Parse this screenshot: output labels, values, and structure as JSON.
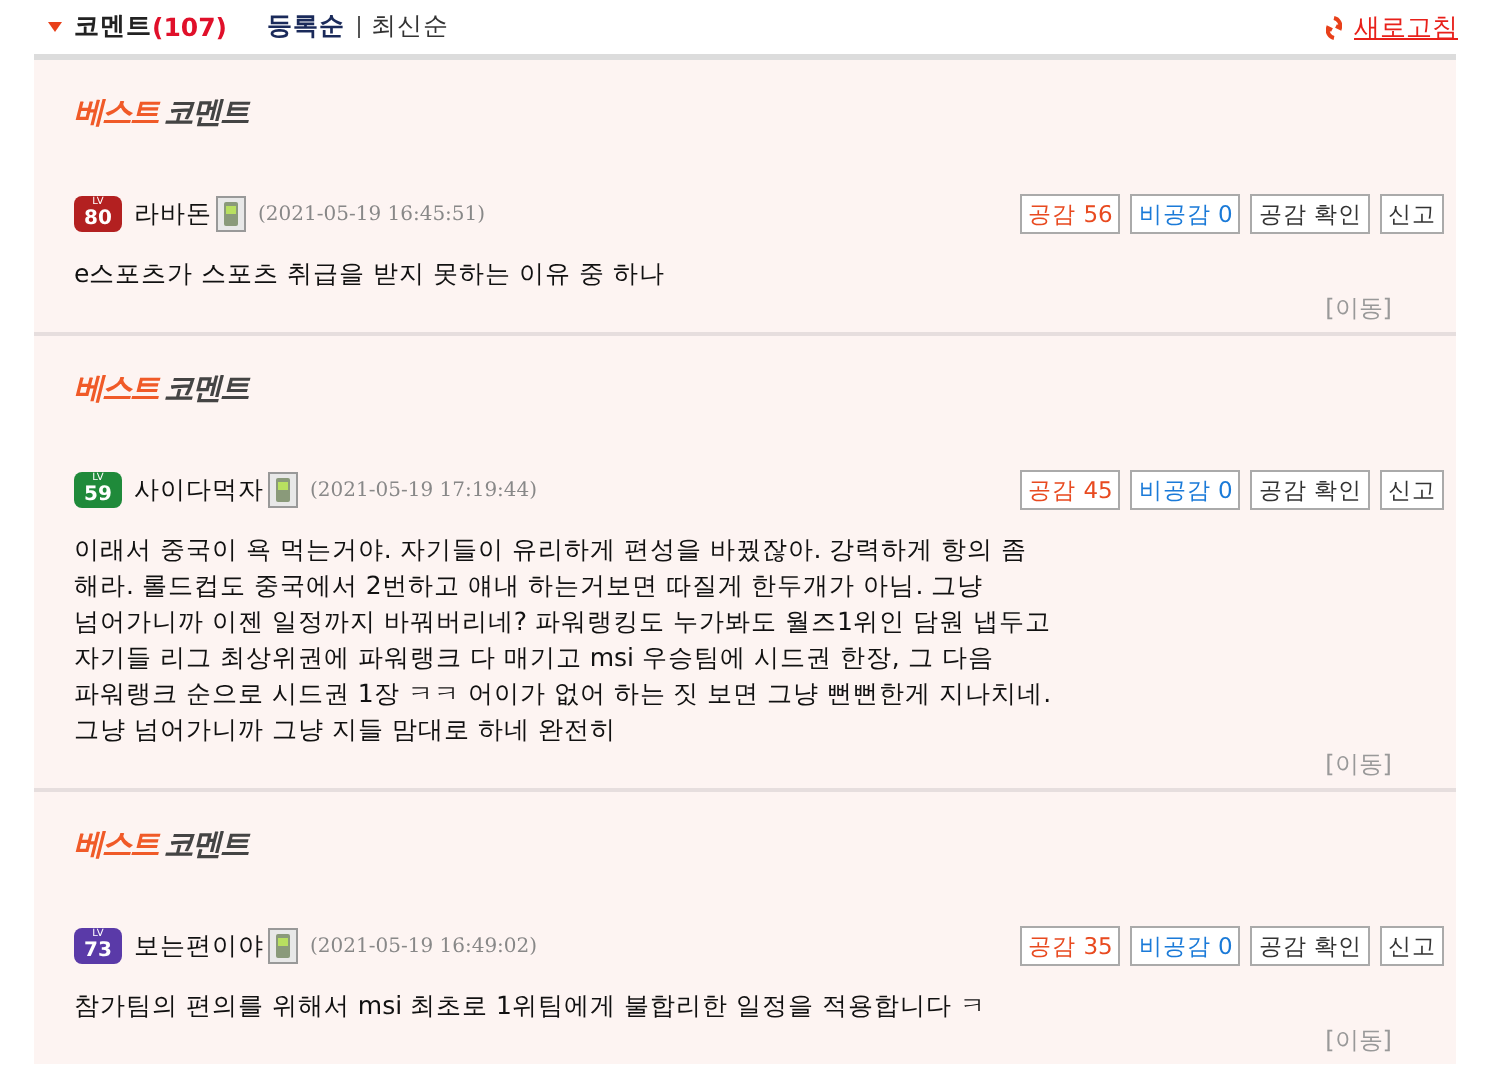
{
  "header": {
    "title": "코멘트",
    "count": "(107)",
    "sort_options": [
      {
        "label": "등록순",
        "selected": true
      },
      {
        "label": "최신순",
        "selected": false
      }
    ],
    "refresh": "새로고침"
  },
  "comments": [
    {
      "best_label": {
        "highlight": "베스트",
        "rest": "코멘트"
      },
      "level": {
        "label": "LV",
        "value": "80",
        "color": "#b32020"
      },
      "author": "라바돈",
      "date": "(2021-05-19 16:45:51)",
      "buttons": {
        "like": "공감 56",
        "dislike": "비공감 0",
        "check": "공감 확인",
        "report": "신고"
      },
      "text": "e스포츠가 스포츠 취급을 받지 못하는 이유 중 하나",
      "move": "[이동]"
    },
    {
      "best_label": {
        "highlight": "베스트",
        "rest": "코멘트"
      },
      "level": {
        "label": "LV",
        "value": "59",
        "color": "#1f8a3a"
      },
      "author": "사이다먹자",
      "date": "(2021-05-19 17:19:44)",
      "buttons": {
        "like": "공감 45",
        "dislike": "비공감 0",
        "check": "공감 확인",
        "report": "신고"
      },
      "text": "이래서 중국이 욕 먹는거야. 자기들이 유리하게 편성을 바꿨잖아. 강력하게 항의 좀 해라. 롤드컵도 중국에서 2번하고 얘내 하는거보면 따질게 한두개가 아님. 그냥 넘어가니까 이젠 일정까지 바꿔버리네? 파워랭킹도 누가봐도 월즈1위인 담원 냅두고 자기들 리그 최상위권에 파워랭크 다 매기고 msi 우승팀에 시드권 한장, 그 다음 파워랭크 순으로 시드권 1장 ㅋㅋ 어이가 없어 하는 짓 보면 그냥 뻔뻔한게 지나치네. 그냥 넘어가니까 그냥 지들 맘대로 하네 완전히",
      "move": "[이동]"
    },
    {
      "best_label": {
        "highlight": "베스트",
        "rest": "코멘트"
      },
      "level": {
        "label": "LV",
        "value": "73",
        "color": "#5a3aa8"
      },
      "author": "보는편이야",
      "date": "(2021-05-19 16:49:02)",
      "buttons": {
        "like": "공감 35",
        "dislike": "비공감 0",
        "check": "공감 확인",
        "report": "신고"
      },
      "text": "참가팀의 편의를 위해서 msi 최초로 1위팀에게 불합리한 일정을 적용합니다 ㅋ",
      "move": "[이동]"
    }
  ]
}
